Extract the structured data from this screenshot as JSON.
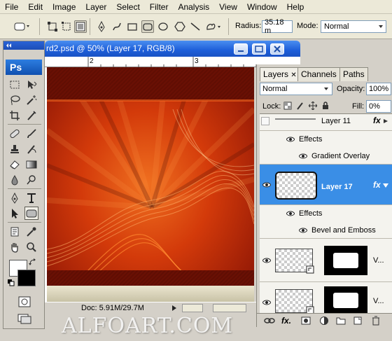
{
  "menu": [
    "File",
    "Edit",
    "Image",
    "Layer",
    "Select",
    "Filter",
    "Analysis",
    "View",
    "Window",
    "Help"
  ],
  "options": {
    "radius_label": "Radius:",
    "radius_value": "35.18 m",
    "mode_label": "Mode:",
    "mode_value": "Normal"
  },
  "tools": {
    "logo": "Ps"
  },
  "document": {
    "title": "rd2.psd @ 50% (Layer 17, RGB/8)",
    "ruler_marks": [
      "2",
      "3"
    ],
    "status": "Doc: 5.91M/29.7M"
  },
  "layers_panel": {
    "tabs": [
      "Layers",
      "Channels",
      "Paths"
    ],
    "blend_mode": "Normal",
    "opacity_label": "Opacity:",
    "opacity_value": "100%",
    "lock_label": "Lock:",
    "fill_label": "Fill:",
    "fill_value": "0%",
    "rows": [
      {
        "name": "Layer 11",
        "fx": "fx"
      },
      {
        "name": "Effects"
      },
      {
        "name": "Gradient Overlay"
      },
      {
        "name": "Layer 17",
        "fx": "fx"
      },
      {
        "name": "Effects"
      },
      {
        "name": "Bevel and Emboss"
      },
      {
        "name": "V..."
      },
      {
        "name": "V..."
      }
    ]
  },
  "watermark": "ALFOART.COM",
  "colors": {
    "title_bar": "#1d5ed9",
    "selected_layer": "#3a8ee6",
    "canvas_red": "#b21a05",
    "canvas_orange": "#e8560f"
  }
}
